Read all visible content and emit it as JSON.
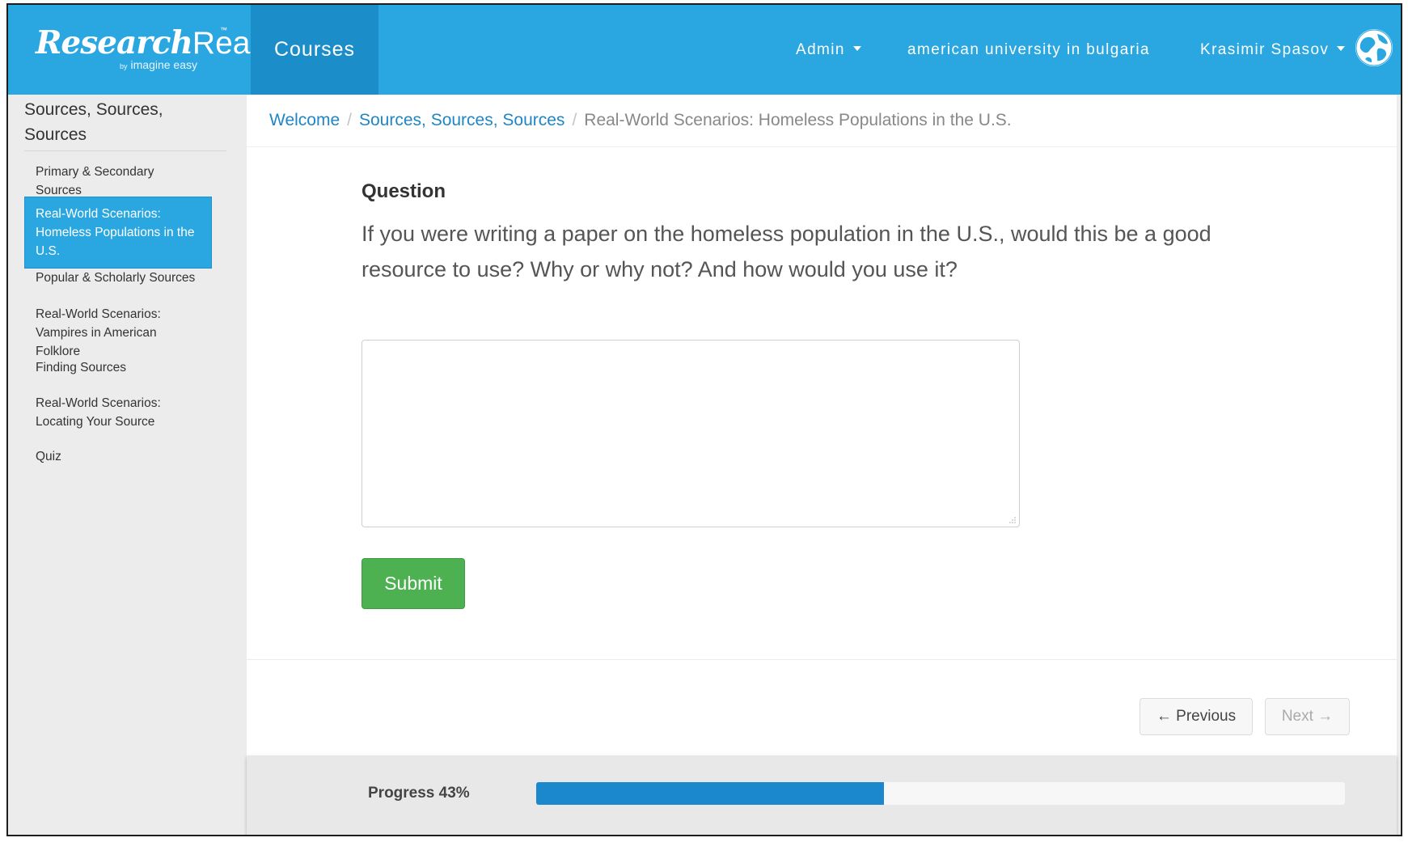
{
  "header": {
    "logo_research": "Research",
    "logo_ready": "Ready",
    "logo_tm": "™",
    "logo_by": "by",
    "logo_sub": "imagine easy",
    "nav_courses": "Courses",
    "admin_label": "Admin",
    "institution": "american university in bulgaria",
    "user_name": "Krasimir Spasov"
  },
  "sidebar": {
    "title": "Sources, Sources, Sources",
    "items": [
      {
        "label": "Primary & Secondary Sources",
        "active": false
      },
      {
        "label": "Real-World Scenarios: Homeless Populations in the U.S.",
        "active": true
      },
      {
        "label": "Popular & Scholarly Sources",
        "active": false
      },
      {
        "label": "Real-World Scenarios: Vampires in American Folklore",
        "active": false
      },
      {
        "label": "Finding Sources",
        "active": false
      },
      {
        "label": "Real-World Scenarios: Locating Your Source",
        "active": false
      },
      {
        "label": "Quiz",
        "active": false
      }
    ]
  },
  "breadcrumb": {
    "items": [
      "Welcome",
      "Sources, Sources, Sources"
    ],
    "separator": "/",
    "current": "Real-World Scenarios: Homeless Populations in the U.S."
  },
  "question": {
    "heading": "Question",
    "text": "If you were writing a paper on the homeless population in the U.S., would this be a good resource to use? Why or why not? And how would you use it?",
    "answer_value": "",
    "submit_label": "Submit"
  },
  "navigation": {
    "previous_label": "← Previous",
    "next_label": "Next →"
  },
  "progress": {
    "label": "Progress 43%",
    "value_percent": 43
  },
  "colors": {
    "topbar": "#2aa7e0",
    "courses_tab": "#1b8dc9",
    "active_sidebar": "#2aa7e0",
    "link": "#1f86c5",
    "submit": "#4db152",
    "progress_fill": "#1b87cc"
  },
  "icons": {
    "user_avatar": "globe-avatar-icon",
    "dropdown": "caret-down-icon",
    "textarea_resize": "resize-grip-icon"
  }
}
